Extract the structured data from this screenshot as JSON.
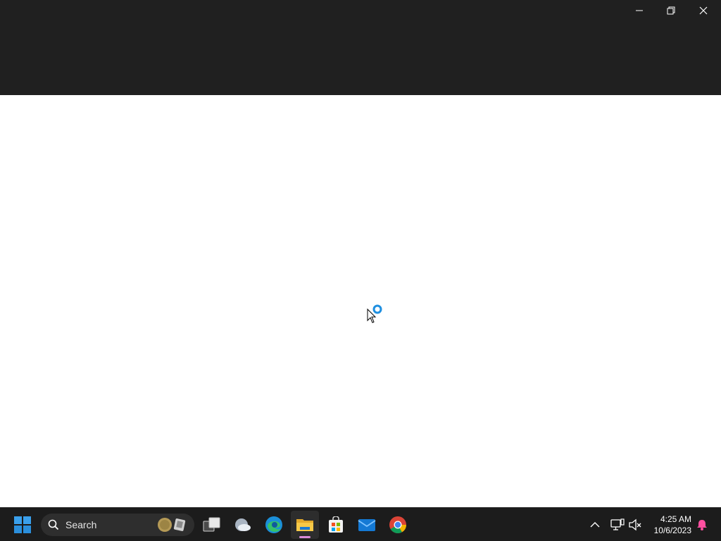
{
  "window": {
    "title_bar_color": "#202020",
    "caption_buttons": [
      "minimize-icon",
      "restore-icon",
      "close-icon"
    ]
  },
  "taskbar": {
    "search": {
      "label": "Search"
    },
    "apps": [
      {
        "name": "start",
        "icon": "windows-logo-icon"
      },
      {
        "name": "task-view",
        "icon": "task-view-icon"
      },
      {
        "name": "weather",
        "icon": "weather-icon"
      },
      {
        "name": "edge",
        "icon": "edge-icon"
      },
      {
        "name": "file-explorer",
        "icon": "folder-icon",
        "active": true
      },
      {
        "name": "microsoft-store",
        "icon": "store-icon"
      },
      {
        "name": "mail",
        "icon": "mail-icon"
      },
      {
        "name": "chrome",
        "icon": "chrome-icon"
      }
    ],
    "tray": {
      "time": "4:25 AM",
      "date": "10/6/2023"
    }
  },
  "colors": {
    "accent": "#0078d4",
    "taskbar_bg": "#1c1c1c",
    "active_indicator": "#d98ad9"
  }
}
